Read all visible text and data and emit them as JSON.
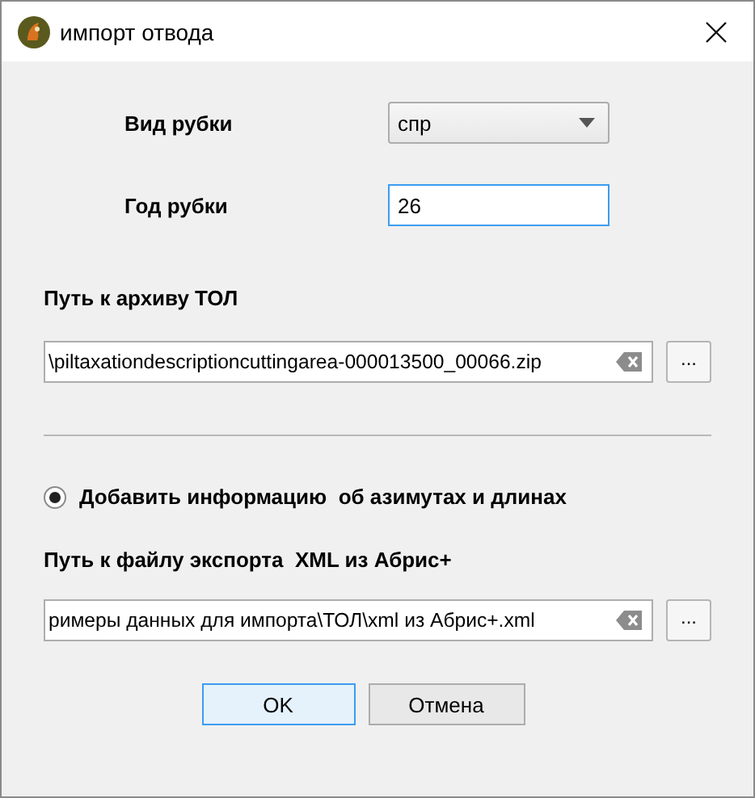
{
  "window": {
    "title": "импорт отвода"
  },
  "fields": [
    {
      "kind": "combo",
      "label": "Вид рубки",
      "value": "спр"
    },
    {
      "kind": "text",
      "label": "Год рубки",
      "value": "26",
      "focused": true
    }
  ],
  "archive": {
    "label": "Путь к архиву ТОЛ",
    "value": "\\piltaxationdescriptioncuttingarea-000013500_00066.zip",
    "browse": "..."
  },
  "option": {
    "label": "Добавить информацию  об азимутах и длинах",
    "selected": true
  },
  "xml": {
    "label": "Путь к файлу экспорта  XML из Абрис+",
    "value": "римеры данных для импорта\\ТОЛ\\xml из Абрис+.xml",
    "browse": "..."
  },
  "buttons": [
    {
      "label": "OK",
      "default": true
    },
    {
      "label": "Отмена",
      "default": false
    }
  ]
}
